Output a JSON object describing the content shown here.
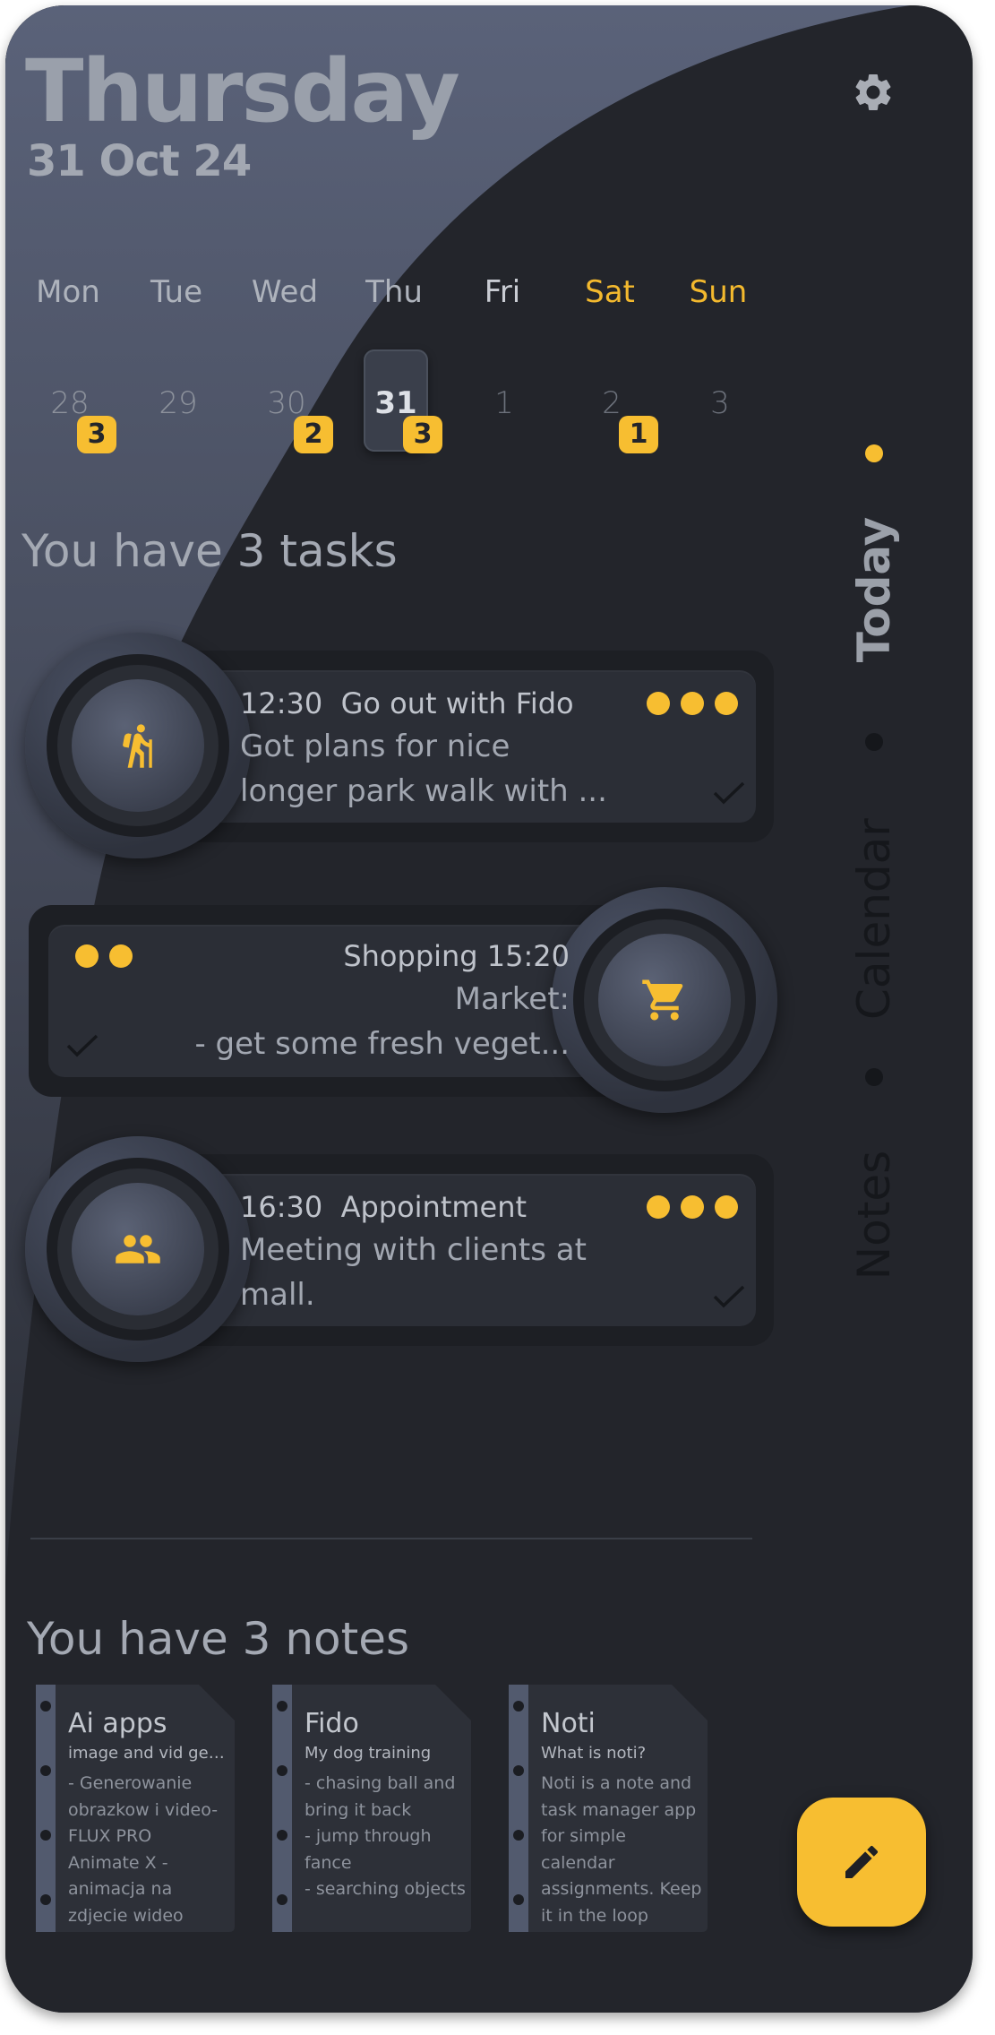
{
  "header": {
    "day": "Thursday",
    "date": "31 Oct 24"
  },
  "week": {
    "days": [
      {
        "name": "Mon",
        "num": "28",
        "badge": "3"
      },
      {
        "name": "Tue",
        "num": "29",
        "badge": ""
      },
      {
        "name": "Wed",
        "num": "30",
        "badge": "2"
      },
      {
        "name": "Thu",
        "num": "31",
        "badge": "3"
      },
      {
        "name": "Fri",
        "num": "1",
        "badge": ""
      },
      {
        "name": "Sat",
        "num": "2",
        "badge": "1"
      },
      {
        "name": "Sun",
        "num": "3",
        "badge": ""
      }
    ],
    "selected_index": 3
  },
  "tasks_heading": "You have 3 tasks",
  "tasks": [
    {
      "time": "12:30",
      "title": "Go out with Fido",
      "line1": "Got plans for nice",
      "line2": "longer park walk with ...",
      "priority_dots": 3,
      "icon": "hiking-icon"
    },
    {
      "time": "15:20",
      "title": "Shopping",
      "line1": "Market:",
      "line2": "- get some fresh veget...",
      "priority_dots": 2,
      "icon": "shopping-cart-icon"
    },
    {
      "time": "16:30",
      "title": "Appointment",
      "line1": "Meeting with clients at",
      "line2": "mall.",
      "priority_dots": 3,
      "icon": "people-icon"
    }
  ],
  "nav": {
    "today": "Today",
    "calendar": "Calendar",
    "notes": "Notes"
  },
  "notes_heading": "You have 3 notes",
  "notes": [
    {
      "title": "Ai apps",
      "subtitle": "image and vid gene...",
      "body": "- Generowanie\nobrazkow i video-\nFLUX PRO\nAnimate X -\nanimacja na\nzdjecie wideo"
    },
    {
      "title": "Fido",
      "subtitle": "My dog training",
      "body": "- chasing ball and\nbring it back\n- jump through\nfance\n- searching objects"
    },
    {
      "title": "Noti",
      "subtitle": "What is noti?",
      "body": "Noti is a note and\ntask manager app\nfor simple\ncalendar\nassignments. Keep\nit in the loop"
    }
  ],
  "colors": {
    "accent": "#f7be31",
    "background": "#23252b",
    "panel": "#525a6e"
  }
}
